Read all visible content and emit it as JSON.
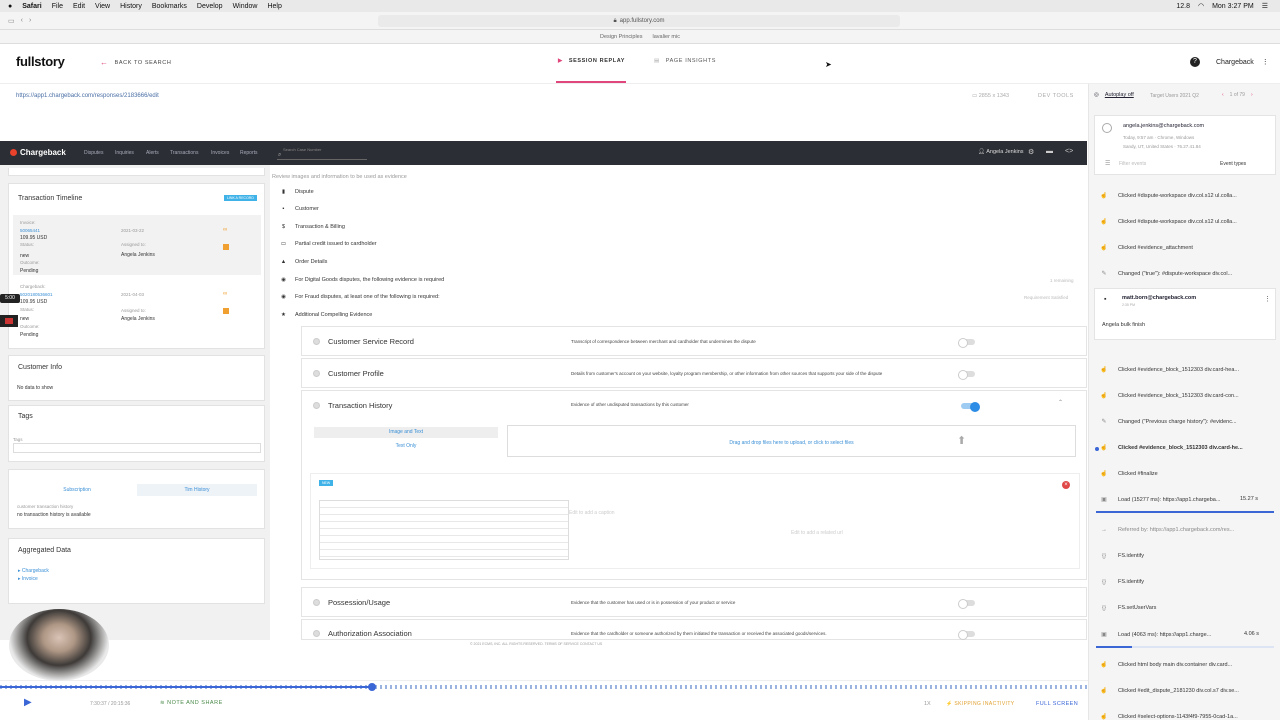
{
  "menubar": {
    "apple": "",
    "items": [
      "Safari",
      "File",
      "Edit",
      "View",
      "History",
      "Bookmarks",
      "Develop",
      "Window",
      "Help"
    ],
    "clock": "Mon 3:27 PM",
    "battery": "12.8"
  },
  "browser": {
    "url": "app.fullstory.com",
    "favorites": [
      "Design Principles",
      "lavalier mic"
    ]
  },
  "fs": {
    "logo": "fullstory",
    "back": "BACK TO SEARCH",
    "tab_replay": "SESSION REPLAY",
    "tab_insights": "PAGE INSIGHTS",
    "help": "?",
    "org": "Chargeback",
    "url": "https://app1.chargeback.com/responses/2183666/edit",
    "dims": "2855 x 1343",
    "devtools": "DEV TOOLS"
  },
  "cb": {
    "logo": "Chargeback",
    "nav": [
      "Disputes",
      "Inquiries",
      "Alerts",
      "Transactions",
      "Invoices",
      "Reports"
    ],
    "search_placeholder": "Search Case Number",
    "user": "Angela Jenkins"
  },
  "left": {
    "timeline_title": "Transaction Timeline",
    "timeline_badge": "LINK A RECORD",
    "t1": {
      "label": "Invoice:",
      "link": "50065441",
      "amount": "109.95 USD",
      "status_label": "Status:",
      "status": "new",
      "outcome_label": "Outcome:",
      "outcome": "Pending",
      "date": "2021-03-22",
      "assigned_label": "Assigned to:",
      "assigned": "Angela Jenkins"
    },
    "t2": {
      "label": "Chargeback:",
      "link": "5020180536601",
      "amount": "109.95 USD",
      "status_label": "Status:",
      "status": "new",
      "outcome_label": "Outcome:",
      "outcome": "Pending",
      "date": "2021-04-03",
      "assigned_label": "Assigned to:",
      "assigned": "Angela Jenkins"
    },
    "customer_info": "Customer Info",
    "no_data": "No data to show",
    "tags": "Tags",
    "tags_label": "Tags",
    "sub_tab": "Subscription",
    "tim_tab": "Tim History",
    "cth": "customer transaction history",
    "no_hist": "no transaction history is available",
    "agg": "Aggregated Data",
    "agg1": "Chargeback",
    "agg2": "Invoice"
  },
  "center": {
    "review": "Review images and information to be used as evidence",
    "cats": [
      {
        "icon": "▮",
        "label": "Dispute"
      },
      {
        "icon": "▪",
        "label": "Customer"
      },
      {
        "icon": "$",
        "label": "Transaction & Billing"
      },
      {
        "icon": "▭",
        "label": "Partial credit issued to cardholder"
      },
      {
        "icon": "▲",
        "label": "Order Details"
      },
      {
        "icon": "◉",
        "label": "For Digital Goods disputes, the following evidence is required"
      },
      {
        "icon": "◉",
        "label": "For Fraud disputes, at least one of the following is required:"
      },
      {
        "icon": "★",
        "label": "Additional Compelling Evidence"
      }
    ],
    "remaining": "1 remaining",
    "req": "Requirement Satisfied",
    "rows": {
      "csr": {
        "title": "Customer Service Record",
        "desc": "Transcript of correspondence between merchant and cardholder that undermines the dispute"
      },
      "cp": {
        "title": "Customer Profile",
        "desc": "Details from customer's account on your website, loyalty program membership, or other information from other sources that supports your side of the dispute"
      },
      "th": {
        "title": "Transaction History",
        "desc": "Evidence of other undisputed transactions by this customer"
      },
      "pu": {
        "title": "Possession/Usage",
        "desc": "Evidence that the customer has used or is in possession of your product or service"
      },
      "aa": {
        "title": "Authorization Association",
        "desc": "Evidence that the cardholder or someone authorized by them initiated the transaction or received the associated goods/services."
      }
    },
    "opt_image": "Image and Text",
    "opt_text": "Text Only",
    "dropzone": "Drag and drop files here to upload, or click to select files",
    "caption": "Edit to add a caption",
    "related": "Edit to add a related url",
    "img_badge": "NEW",
    "footer": "© 2021 ECMS, INC. ALL RIGHTS RESERVED.  TERMS OF SERVICE  CONTACT US"
  },
  "right": {
    "autoplay": "Autoplay off",
    "segment": "Target Users 2021 Q2",
    "count": "1 of 79",
    "user_email": "angela.jenkins@chargeback.com",
    "meta1": "Today, 9:57 am  ·  Chrome, Windows",
    "meta2": "Sandy, UT, United States  ·  76.27.41.84",
    "filter": "Filter events",
    "event_types": "Event types",
    "note_user": "matt.born@chargeback.com",
    "note_time": "2:35 PM",
    "note_text": "Angela bulk finish",
    "events_a": [
      "Clicked #dispute-workspace div.col.s12 ul.colla...",
      "Clicked #dispute-workspace div.col.s12 ul.colla...",
      "Clicked #evidence_attachment",
      "Changed (\"true\"): #dispute-workspace div.col..."
    ],
    "events_b": [
      {
        "t": "Clicked #evidence_block_1512303 div.card-hea...",
        "ic": "☝"
      },
      {
        "t": "Clicked #evidence_block_1512303 div.card-con...",
        "ic": "☝"
      },
      {
        "t": "Changed (\"Previous charge history\"): #evidenc...",
        "ic": "✎"
      },
      {
        "t": "Clicked #evidence_block_1512303 div.card-he...",
        "ic": "☝"
      },
      {
        "t": "Clicked #finalize",
        "ic": "☝"
      }
    ],
    "load1": "Load (15277 ms): https://app1.chargeba...",
    "load1_t": "15.27 s",
    "referred": "Referred by: https://app1.chargeback.com/res...",
    "fs1": "FS.identify",
    "fs2": "FS.identify",
    "fs3": "FS.setUserVars",
    "load2": "Load (4063 ms): https://app1.charge...",
    "load2_t": "4.06 s",
    "events_c": [
      "Clicked html body main div.container div.card...",
      "Clicked #edit_dispute_2181230 div.col.s7 div.se...",
      "Clicked #select-options-1143f4f9-7955-0cad-1a..."
    ]
  },
  "player": {
    "time": "7:30:37 / 20:15:36",
    "note": "NOTE AND SHARE",
    "speed": "1X",
    "skip": "SKIPPING INACTIVITY",
    "fullscreen": "FULL SCREEN",
    "badge": "5:00"
  }
}
